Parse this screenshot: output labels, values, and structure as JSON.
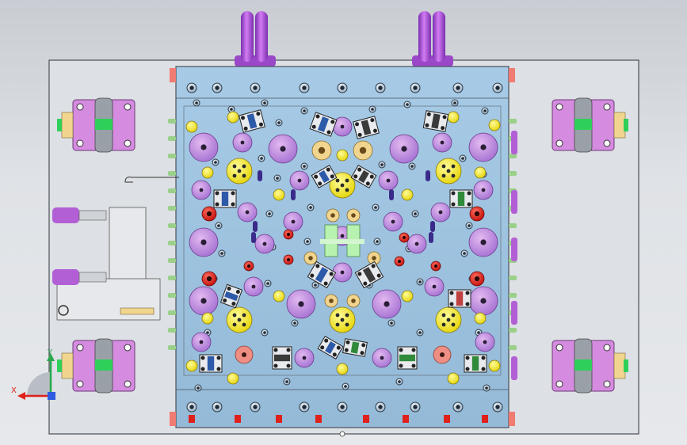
{
  "viewport": {
    "background_top": "#c9cdd3",
    "background_bottom": "#e6e8eb"
  },
  "assembly": {
    "base_plate_color": "#dde0e4",
    "mold_plate_color": "#9ec3e0",
    "outline_color": "#4a4f57"
  },
  "component_colors": {
    "guide_block": "#d58be0",
    "guide_pin": "#2fd05a",
    "ejector_large": "#c28be0",
    "ejector_small": "#a87cd8",
    "locator_yellow": "#f3e826",
    "bushing_peach": "#f1d58e",
    "insert_green": "#b8f2b0",
    "red_pin": "#e0221b",
    "salmon_pin": "#ef8f83",
    "coolant_fitting": "#b25fd6",
    "clamp_blue": "#2d5aa8"
  },
  "orientation_triad": {
    "x_label": "X",
    "y_label": "Y",
    "x_color": "#e0201a",
    "y_color": "#2aa84a",
    "z_color": "#2f5be0"
  }
}
